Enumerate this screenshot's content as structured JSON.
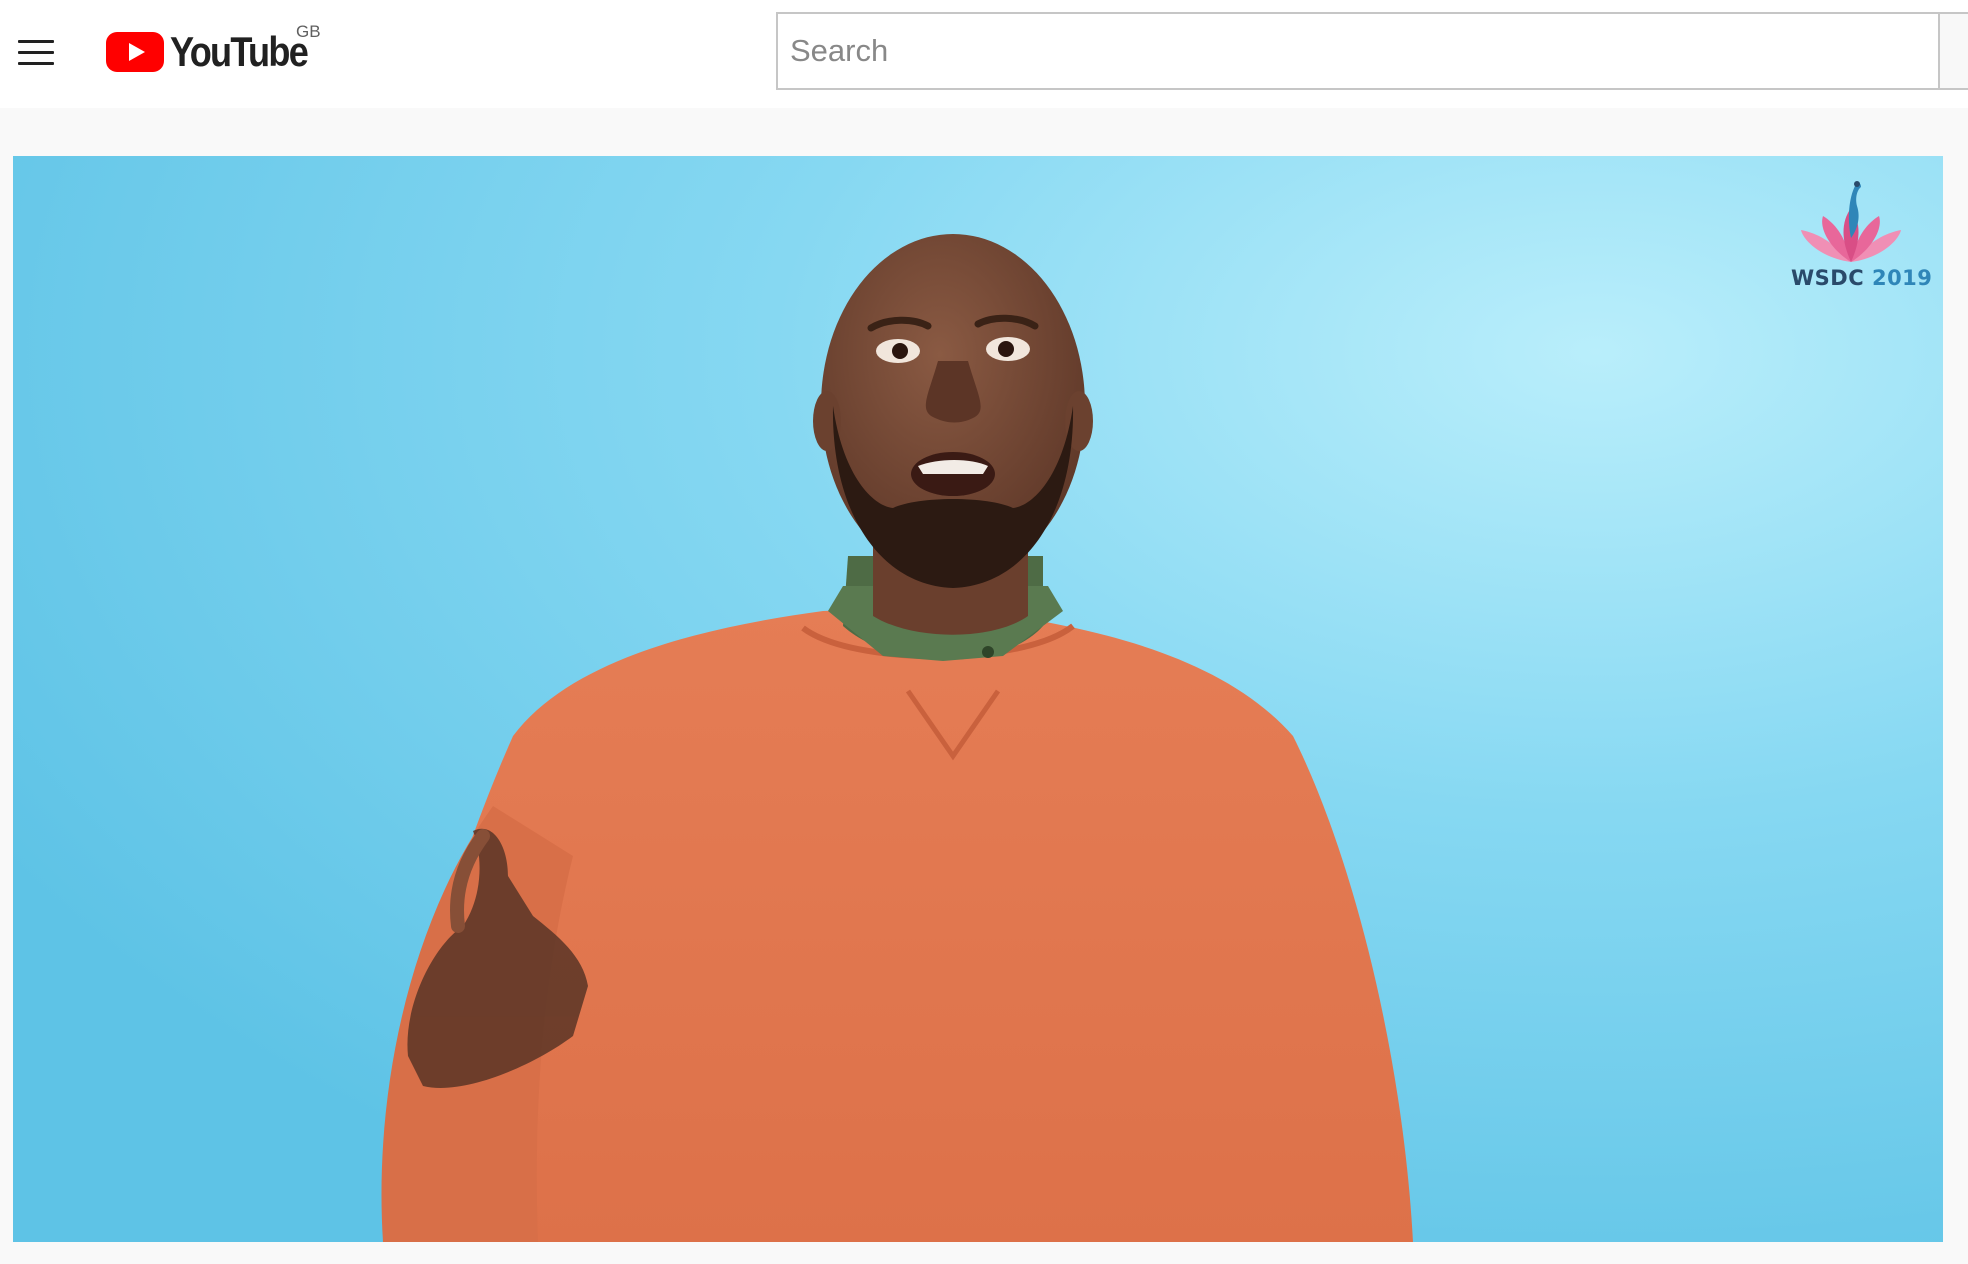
{
  "header": {
    "brand": "YouTube",
    "country_code": "GB",
    "search": {
      "placeholder": "Search",
      "value": ""
    }
  },
  "video": {
    "watermark": {
      "text_primary": "WSDC",
      "text_secondary": "2019"
    }
  },
  "colors": {
    "brand_red": "#ff0000",
    "video_background": "#7fd3ef",
    "header_background": "#ffffff",
    "page_background": "#f9f9f9"
  },
  "icons": {
    "menu": "hamburger-menu-icon",
    "logo": "youtube-play-icon",
    "watermark": "peacock-lotus-logo-icon"
  }
}
